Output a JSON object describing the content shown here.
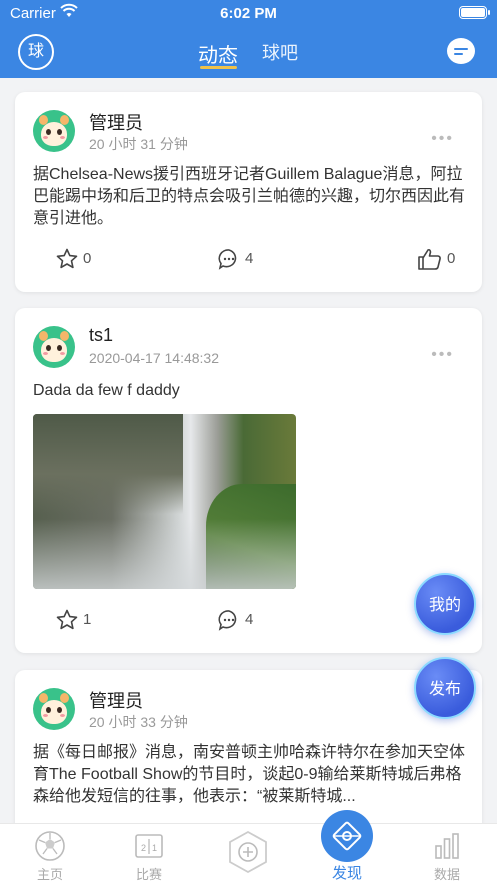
{
  "status_bar": {
    "carrier": "Carrier",
    "time": "6:02 PM"
  },
  "header": {
    "logo_label": "球",
    "tabs": [
      {
        "label": "动态",
        "active": true
      },
      {
        "label": "球吧",
        "active": false
      }
    ]
  },
  "posts": [
    {
      "author": "管理员",
      "time": "20 小时 31 分钟",
      "content": "据Chelsea-News援引西班牙记者Guillem Balague消息，阿拉巴能踢中场和后卫的特点会吸引兰帕德的兴趣，切尔西因此有意引进他。",
      "favorites": "0",
      "comments": "4",
      "likes": "0"
    },
    {
      "author": "ts1",
      "time": "2020-04-17 14:48:32",
      "content": "Dada da few f daddy",
      "favorites": "1",
      "comments": "4"
    },
    {
      "author": "管理员",
      "time": "20 小时 33 分钟",
      "content": "据《每日邮报》消息，南安普顿主帅哈森许特尔在参加天空体育The Football Show的节目时，谈起0-9输给莱斯特城后弗格森给他发短信的往事，他表示：“被莱斯特城..."
    }
  ],
  "fabs": {
    "mine": "我的",
    "publish": "发布"
  },
  "tabbar": [
    {
      "label": "主页"
    },
    {
      "label": "比赛"
    },
    {
      "label": ""
    },
    {
      "label": "发现"
    },
    {
      "label": "数据"
    }
  ],
  "colors": {
    "primary": "#3b86e3",
    "accent": "#f0c24a"
  }
}
